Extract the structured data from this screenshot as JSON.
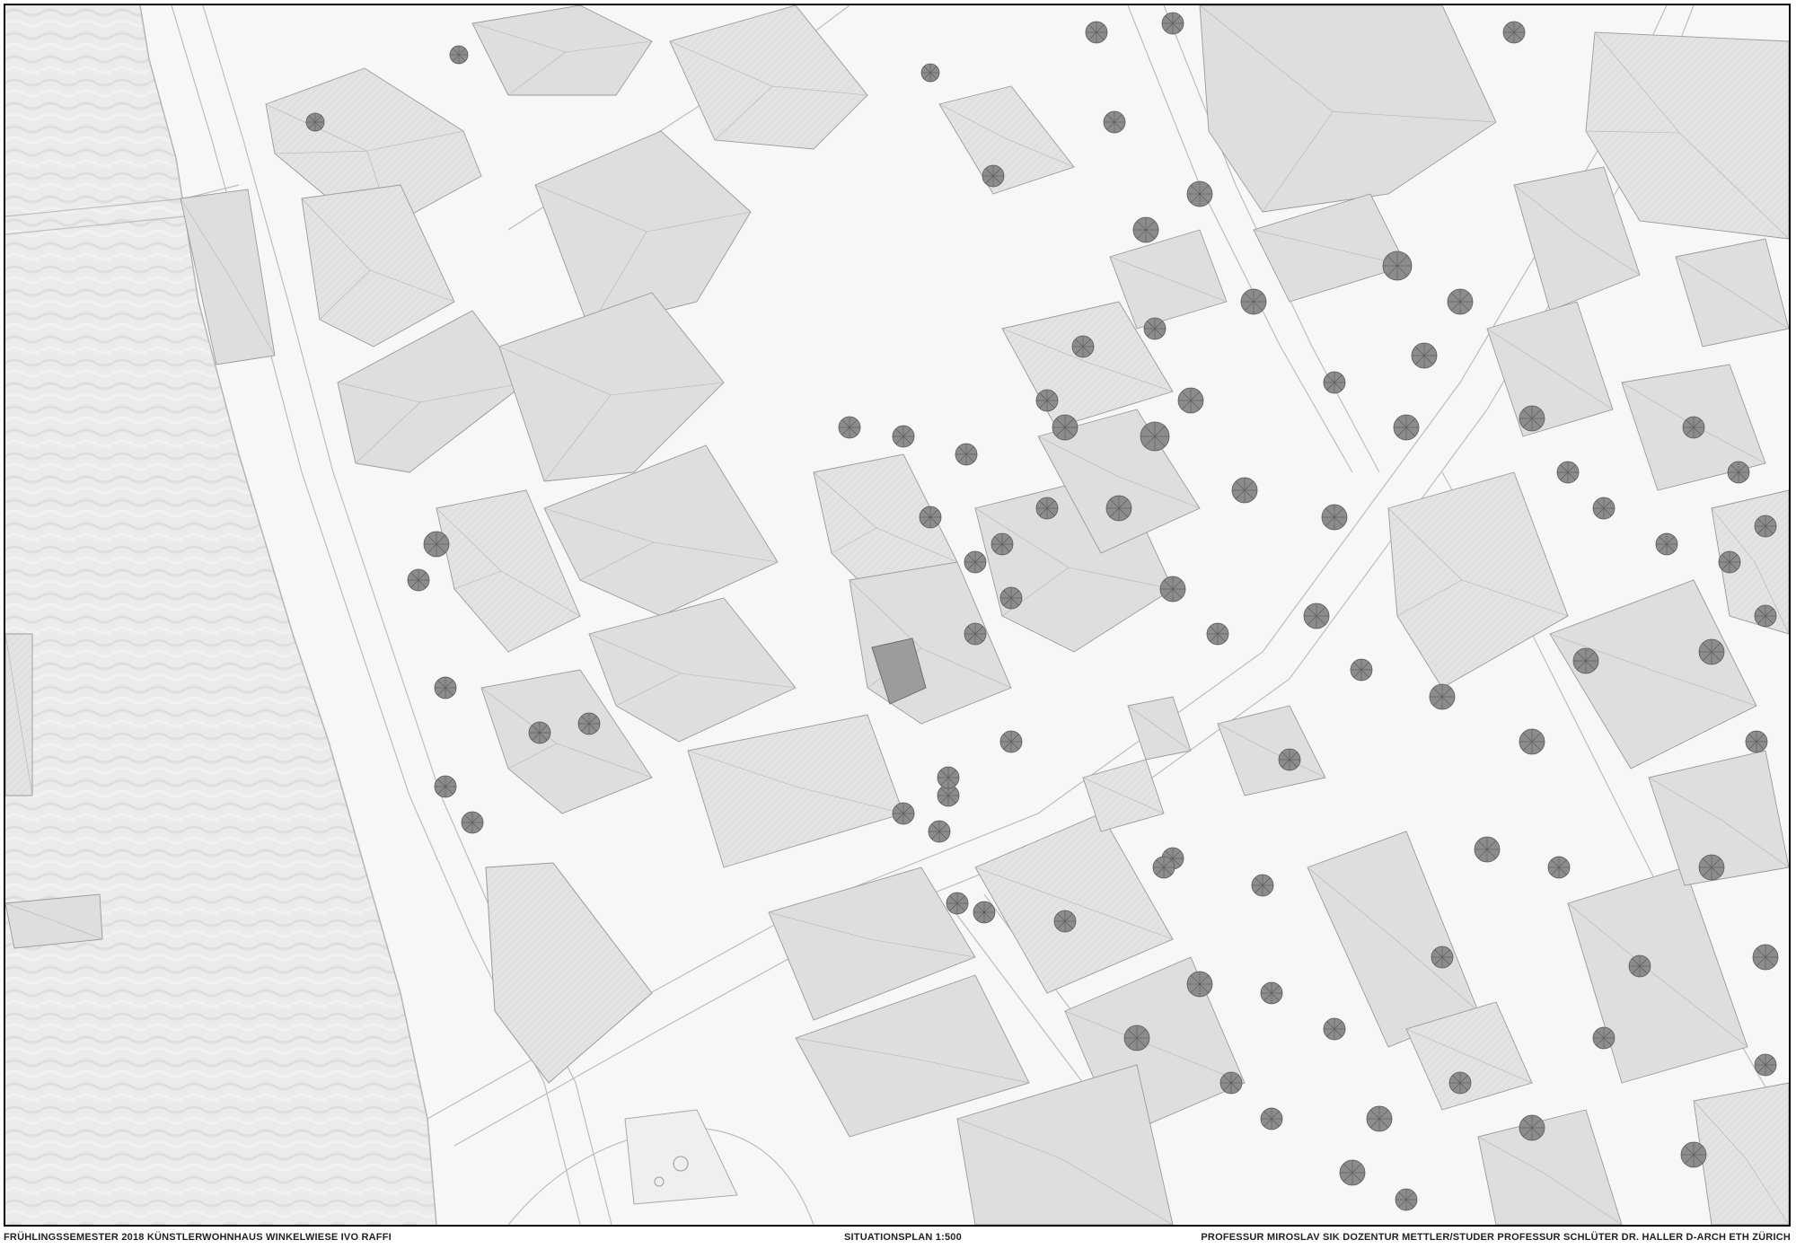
{
  "footer": {
    "left": "FRÜHLINGSSEMESTER 2018 KÜNSTLERWOHNHAUS WINKELWIESE    IVO RAFFI",
    "center": "SITUATIONSPLAN 1:500",
    "right": "PROFESSUR MIROSLAV SIK DOZENTUR METTLER/STUDER PROFESSUR SCHLÜTER DR. HALLER D-ARCH ETH ZÜRICH"
  },
  "colors": {
    "paper": "#f7f7f7",
    "water": "#ebebeb",
    "building": "#dedede",
    "building_stroke": "#9a9a9a",
    "project_building": "#9c9c9c",
    "tree": "#7a7a7a",
    "road_line": "#b8b8b8",
    "frame": "#000000"
  },
  "icons": {
    "tree": "tree-symbol",
    "project": "project-building-highlight"
  }
}
